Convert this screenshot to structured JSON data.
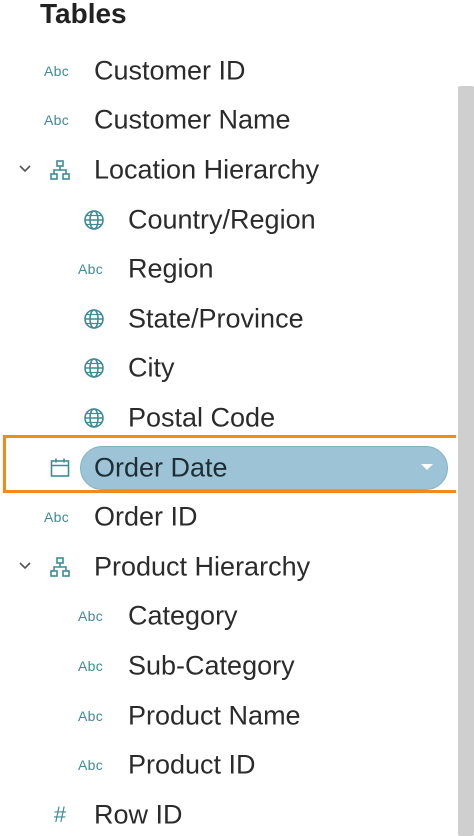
{
  "panel": {
    "title": "Tables"
  },
  "fields": [
    {
      "label": "Customer ID",
      "type_icon": "abc",
      "icon_text": "Abc",
      "level": 0
    },
    {
      "label": "Customer Name",
      "type_icon": "abc",
      "icon_text": "Abc",
      "level": 0
    },
    {
      "label": "Location Hierarchy",
      "type_icon": "hierarchy-icon",
      "level": 0,
      "expanded": true
    },
    {
      "label": "Country/Region",
      "type_icon": "globe-icon",
      "level": 1
    },
    {
      "label": "Region",
      "type_icon": "abc",
      "icon_text": "Abc",
      "level": 1
    },
    {
      "label": "State/Province",
      "type_icon": "globe-icon",
      "level": 1
    },
    {
      "label": "City",
      "type_icon": "globe-icon",
      "level": 1
    },
    {
      "label": "Postal Code",
      "type_icon": "globe-icon",
      "level": 1
    },
    {
      "label": "Order Date",
      "type_icon": "calendar-icon",
      "level": 0,
      "selected": true
    },
    {
      "label": "Order ID",
      "type_icon": "abc",
      "icon_text": "Abc",
      "level": 0
    },
    {
      "label": "Product Hierarchy",
      "type_icon": "hierarchy-icon",
      "level": 0,
      "expanded": true
    },
    {
      "label": "Category",
      "type_icon": "abc",
      "icon_text": "Abc",
      "level": 1
    },
    {
      "label": "Sub-Category",
      "type_icon": "abc",
      "icon_text": "Abc",
      "level": 1
    },
    {
      "label": "Product Name",
      "type_icon": "abc",
      "icon_text": "Abc",
      "level": 1
    },
    {
      "label": "Product ID",
      "type_icon": "abc",
      "icon_text": "Abc",
      "level": 1
    },
    {
      "label": "Row ID",
      "type_icon": "number-icon",
      "icon_text": "#",
      "level": 0
    }
  ],
  "colors": {
    "icon": "#3f8c96",
    "selected_pill": "#9cc4d6",
    "highlight": "#f28a19",
    "scrollbar": "#cfcfcf"
  }
}
